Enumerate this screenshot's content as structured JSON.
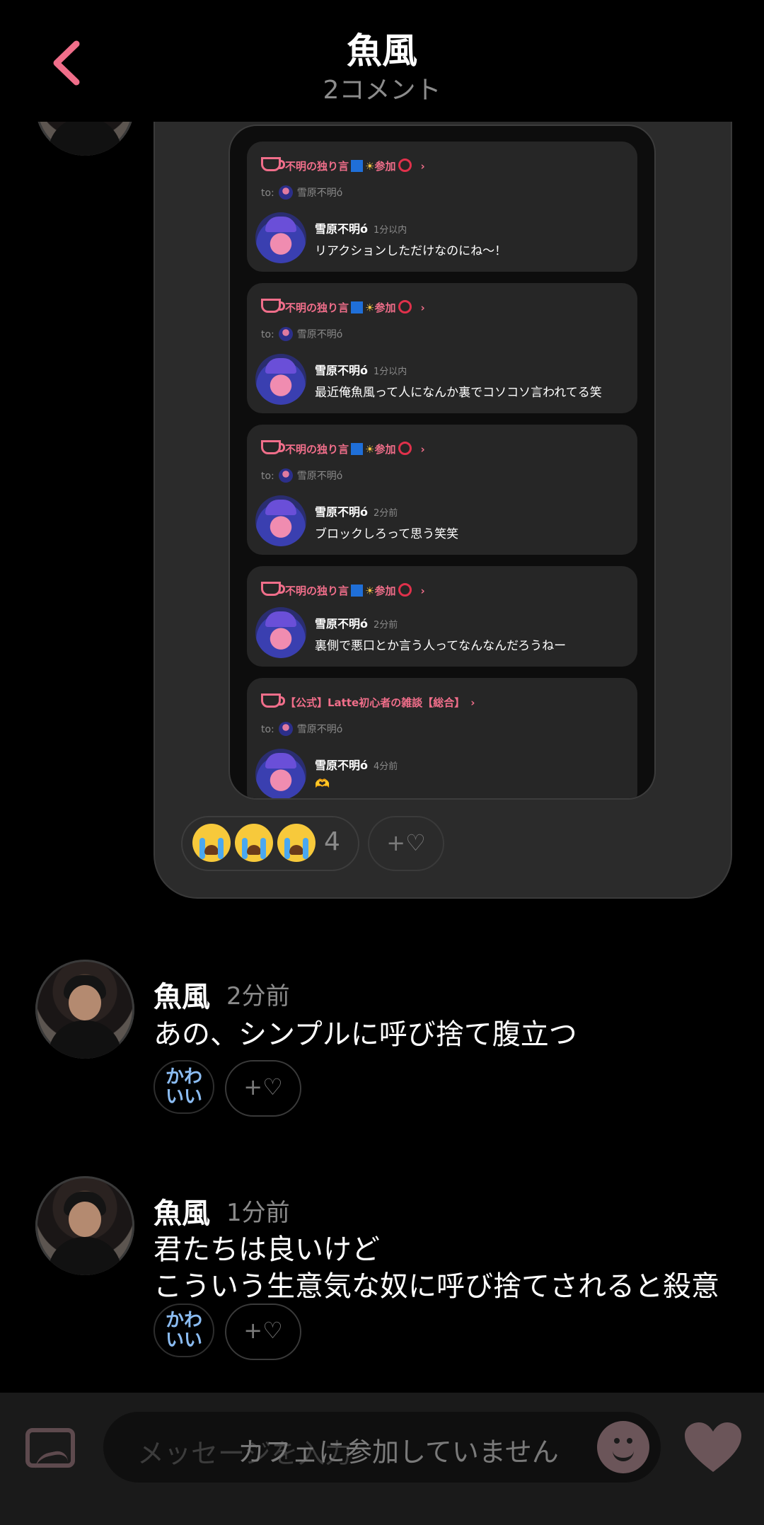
{
  "header": {
    "title": "魚風",
    "subtitle": "2コメント"
  },
  "embedded_posts": [
    {
      "cafe": "不明の独り言",
      "participation": "参加",
      "to_label": "to:",
      "to_user": "雪原不明ó",
      "author": "雪原不明ó",
      "time": "1分以内",
      "message": "リアクションしただけなのにね～！"
    },
    {
      "cafe": "不明の独り言",
      "participation": "参加",
      "to_label": "to:",
      "to_user": "雪原不明ó",
      "author": "雪原不明ó",
      "time": "1分以内",
      "message": "最近俺魚風って人になんか裏でコソコソ言われてる笑"
    },
    {
      "cafe": "不明の独り言",
      "participation": "参加",
      "to_label": "to:",
      "to_user": "雪原不明ó",
      "author": "雪原不明ó",
      "time": "2分前",
      "message": "ブロックしろって思う笑笑"
    },
    {
      "cafe": "不明の独り言",
      "participation": "参加",
      "author": "雪原不明ó",
      "time": "2分前",
      "message": "裏側で悪口とか言う人ってなんなんだろうねー"
    },
    {
      "cafe": "【公式】Latte初心者の雑談【総合】",
      "to_label": "to:",
      "to_user": "雪原不明ó",
      "author": "雪原不明ó",
      "time": "4分前",
      "message": "🫶"
    }
  ],
  "reactions": {
    "count": "4",
    "add_label": "+♡"
  },
  "comments": [
    {
      "author": "魚風",
      "time": "2分前",
      "lines": [
        "あの、シンプルに呼び捨て腹立つ"
      ],
      "reaction_line1": "かわ",
      "reaction_line2": "いい",
      "add_label": "+♡"
    },
    {
      "author": "魚風",
      "time": "1分前",
      "lines": [
        "君たちは良いけど",
        "こういう生意気な奴に呼び捨てされると殺意"
      ],
      "reaction_line1": "かわ",
      "reaction_line2": "いい",
      "add_label": "+♡"
    }
  ],
  "input": {
    "placeholder": "メッセージを入力",
    "disabled_notice": "カフェに参加していません"
  },
  "colors": {
    "accent": "#f06e8a",
    "background": "#000000",
    "bubble": "#2b2b2b",
    "kawaii": "#8bbcf2"
  },
  "icons": {
    "back": "chevron-left-icon",
    "image": "image-icon",
    "emoji": "smile-icon",
    "like": "heart-icon"
  }
}
